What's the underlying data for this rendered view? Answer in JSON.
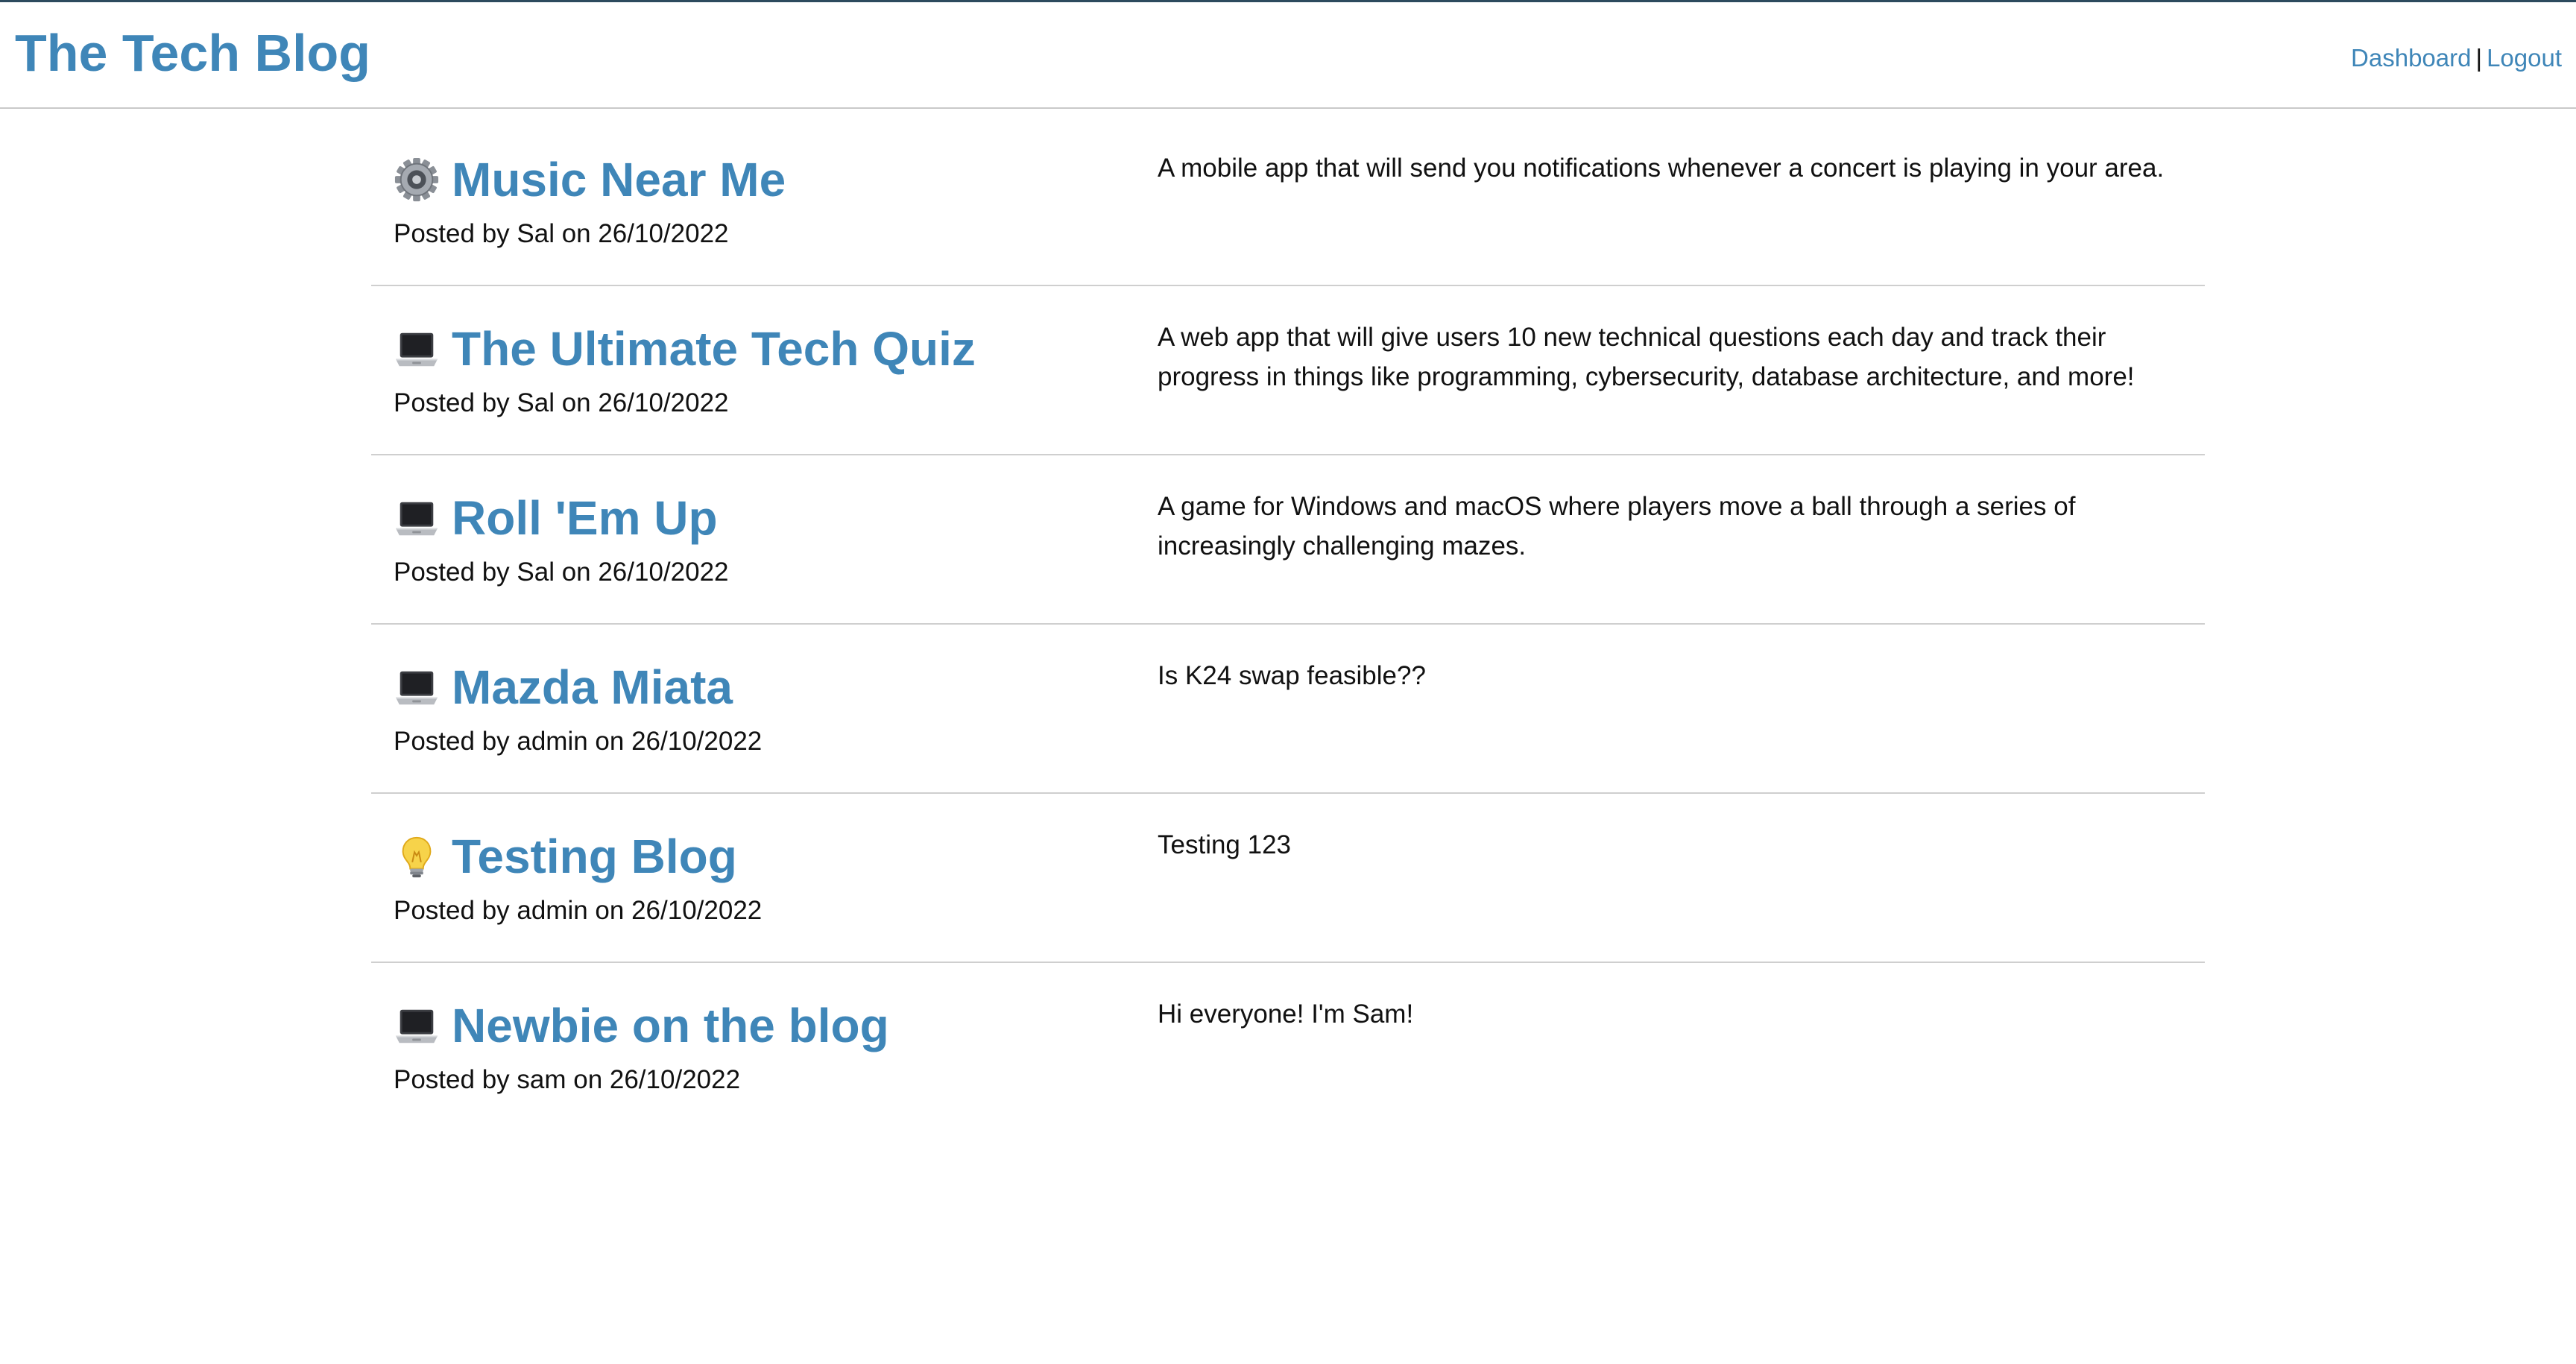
{
  "header": {
    "site_title": "The Tech Blog",
    "nav": {
      "dashboard_label": "Dashboard",
      "separator": "|",
      "logout_label": "Logout"
    }
  },
  "colors": {
    "accent": "#3f86b8",
    "text": "#111111",
    "divider": "#cfcfcf",
    "header_top_border": "#2c4a5e"
  },
  "posts": [
    {
      "icon": "gear-icon",
      "title": "Music Near Me",
      "meta": "Posted by Sal on 26/10/2022",
      "body": "A mobile app that will send you notifications whenever a concert is playing in your area."
    },
    {
      "icon": "laptop-icon",
      "title": "The Ultimate Tech Quiz",
      "meta": "Posted by Sal on 26/10/2022",
      "body": "A web app that will give users 10 new technical questions each day and track their progress in things like programming, cybersecurity, database architecture, and more!"
    },
    {
      "icon": "laptop-icon",
      "title": "Roll 'Em Up",
      "meta": "Posted by Sal on 26/10/2022",
      "body": "A game for Windows and macOS where players move a ball through a series of increasingly challenging mazes."
    },
    {
      "icon": "laptop-icon",
      "title": "Mazda Miata",
      "meta": "Posted by admin on 26/10/2022",
      "body": "Is K24 swap feasible??"
    },
    {
      "icon": "lightbulb-icon",
      "title": "Testing Blog",
      "meta": "Posted by admin on 26/10/2022",
      "body": "Testing 123"
    },
    {
      "icon": "laptop-icon",
      "title": "Newbie on the blog",
      "meta": "Posted by sam on 26/10/2022",
      "body": "Hi everyone! I'm Sam!"
    }
  ]
}
